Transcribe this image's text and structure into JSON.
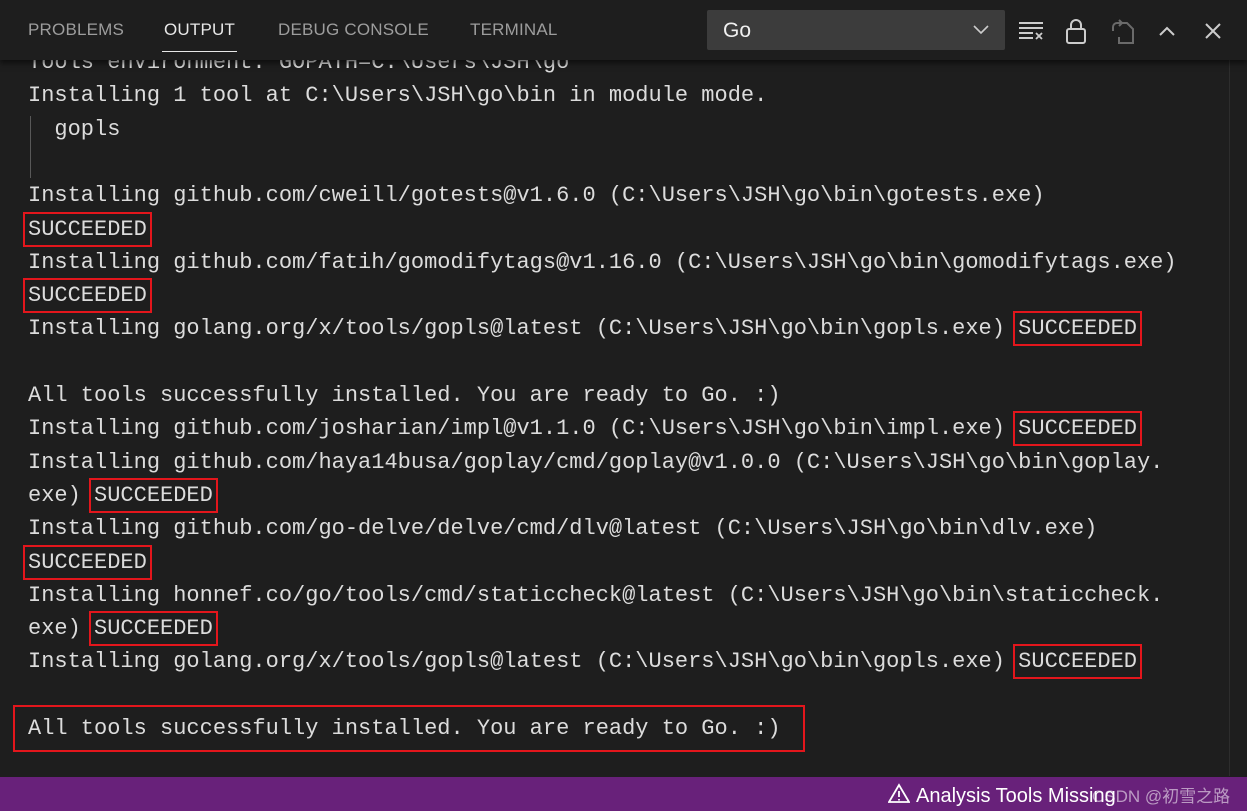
{
  "panel": {
    "tabs": [
      {
        "label": "PROBLEMS",
        "active": false
      },
      {
        "label": "OUTPUT",
        "active": true
      },
      {
        "label": "DEBUG CONSOLE",
        "active": false
      },
      {
        "label": "TERMINAL",
        "active": false
      }
    ],
    "channel_select": {
      "value": "Go"
    },
    "actions": [
      "clear-output-icon",
      "lock-icon",
      "open-in-editor-icon",
      "maximize-chevron-up-icon",
      "close-icon"
    ]
  },
  "output": {
    "lines": [
      {
        "segments": [
          {
            "text": "Tools environment: GOPATH=C:\\Users\\JSH\\go"
          }
        ]
      },
      {
        "segments": [
          {
            "text": "Installing 1 tool at C:\\Users\\JSH\\go\\bin in module mode."
          }
        ]
      },
      {
        "segments": [
          {
            "text": "  gopls"
          }
        ]
      },
      {
        "segments": [
          {
            "text": ""
          }
        ]
      },
      {
        "segments": [
          {
            "text": "Installing github.com/cweill/gotests@v1.6.0 (C:\\Users\\JSH\\go\\bin\\gotests.exe)"
          }
        ]
      },
      {
        "segments": [
          {
            "text": "SUCCEEDED",
            "boxed": true
          }
        ]
      },
      {
        "segments": [
          {
            "text": "Installing github.com/fatih/gomodifytags@v1.16.0 (C:\\Users\\JSH\\go\\bin\\gomodifytags.exe)"
          }
        ]
      },
      {
        "segments": [
          {
            "text": "SUCCEEDED",
            "boxed": true
          }
        ]
      },
      {
        "segments": [
          {
            "text": "Installing golang.org/x/tools/gopls@latest (C:\\Users\\JSH\\go\\bin\\gopls.exe) "
          },
          {
            "text": "SUCCEEDED",
            "boxed": true
          }
        ]
      },
      {
        "segments": [
          {
            "text": ""
          }
        ]
      },
      {
        "segments": [
          {
            "text": "All tools successfully installed. You are ready to Go. :)"
          }
        ]
      },
      {
        "segments": [
          {
            "text": "Installing github.com/josharian/impl@v1.1.0 (C:\\Users\\JSH\\go\\bin\\impl.exe) "
          },
          {
            "text": "SUCCEEDED",
            "boxed": true
          }
        ]
      },
      {
        "segments": [
          {
            "text": "Installing github.com/haya14busa/goplay/cmd/goplay@v1.0.0 (C:\\Users\\JSH\\go\\bin\\goplay."
          }
        ]
      },
      {
        "segments": [
          {
            "text": "exe) "
          },
          {
            "text": "SUCCEEDED",
            "boxed": true
          }
        ]
      },
      {
        "segments": [
          {
            "text": "Installing github.com/go-delve/delve/cmd/dlv@latest (C:\\Users\\JSH\\go\\bin\\dlv.exe)"
          }
        ]
      },
      {
        "segments": [
          {
            "text": "SUCCEEDED",
            "boxed": true
          }
        ]
      },
      {
        "segments": [
          {
            "text": "Installing honnef.co/go/tools/cmd/staticcheck@latest (C:\\Users\\JSH\\go\\bin\\staticcheck."
          }
        ]
      },
      {
        "segments": [
          {
            "text": "exe) "
          },
          {
            "text": "SUCCEEDED",
            "boxed": true
          }
        ]
      },
      {
        "segments": [
          {
            "text": "Installing golang.org/x/tools/gopls@latest (C:\\Users\\JSH\\go\\bin\\gopls.exe) "
          },
          {
            "text": "SUCCEEDED",
            "boxed": true
          }
        ]
      },
      {
        "segments": [
          {
            "text": ""
          }
        ]
      },
      {
        "segments": [
          {
            "text": "All tools successfully installed. You are ready to Go. :)",
            "boxed": true,
            "big": true
          }
        ]
      }
    ],
    "highlight_color": "#e3161c"
  },
  "statusbar": {
    "warning_label": "Analysis Tools Missing",
    "watermark": "CSDN @初雪之路",
    "background": "#68217a"
  }
}
